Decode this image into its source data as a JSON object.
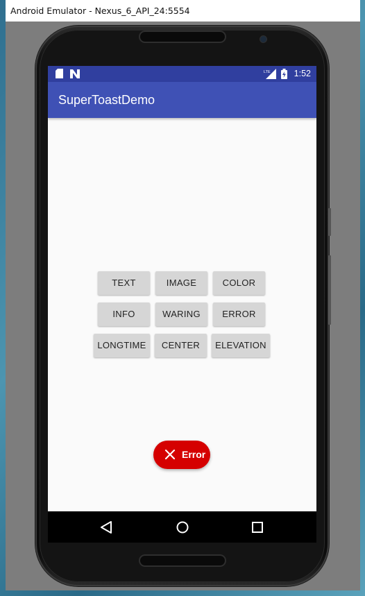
{
  "window": {
    "title": "Android Emulator - Nexus_6_API_24:5554"
  },
  "statusbar": {
    "time": "1:52",
    "left_icons": [
      "sd-card-icon",
      "android-n-icon"
    ],
    "right_icons": [
      "lte-signal-icon",
      "battery-charging-icon"
    ]
  },
  "app": {
    "title": "SuperToastDemo",
    "colors": {
      "primary": "#3f51b5",
      "primary_dark": "#303f9f",
      "error": "#d50000"
    }
  },
  "buttons": {
    "row1": [
      "TEXT",
      "IMAGE",
      "COLOR"
    ],
    "row2": [
      "INFO",
      "WARING",
      "ERROR"
    ],
    "row3": [
      "LONGTIME",
      "CENTER",
      "ELEVATION"
    ]
  },
  "toast": {
    "icon": "close-icon",
    "label": "Error"
  },
  "navbar": {
    "icons": [
      "back-icon",
      "home-icon",
      "recents-icon"
    ]
  }
}
